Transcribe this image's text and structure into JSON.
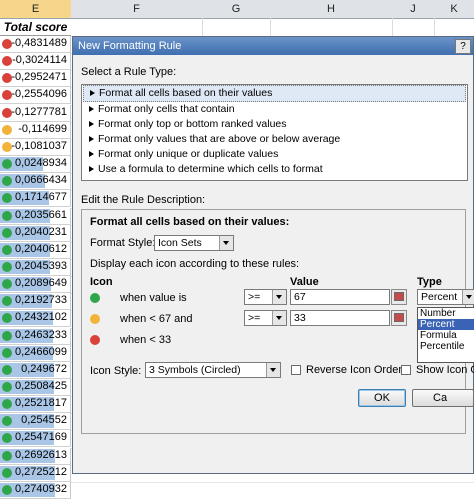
{
  "sheet": {
    "columns": [
      {
        "label": "E",
        "selected": true
      },
      {
        "label": "F",
        "selected": false
      },
      {
        "label": "G",
        "selected": false
      },
      {
        "label": "H",
        "selected": false
      },
      {
        "label": "J",
        "selected": false
      },
      {
        "label": "K",
        "selected": false
      }
    ],
    "header_cell": "Total score",
    "rows": [
      {
        "value": "-0,4831489",
        "icon": "red",
        "bar": 0.0
      },
      {
        "value": "-0,3024114",
        "icon": "red",
        "bar": 0.0
      },
      {
        "value": "-0,2952471",
        "icon": "red",
        "bar": 0.0
      },
      {
        "value": "-0,2554096",
        "icon": "red",
        "bar": 0.0
      },
      {
        "value": "-0,1277781",
        "icon": "red",
        "bar": 0.0
      },
      {
        "value": "-0,114699",
        "icon": "yellow",
        "bar": 0.0
      },
      {
        "value": "-0,1081037",
        "icon": "yellow",
        "bar": 0.0
      },
      {
        "value": "0,0248934",
        "icon": "green",
        "bar": 0.62
      },
      {
        "value": "0,0666434",
        "icon": "green",
        "bar": 0.64
      },
      {
        "value": "0,1714677",
        "icon": "green",
        "bar": 0.7
      },
      {
        "value": "0,2035661",
        "icon": "green",
        "bar": 0.72
      },
      {
        "value": "0,2040231",
        "icon": "green",
        "bar": 0.72
      },
      {
        "value": "0,2040612",
        "icon": "green",
        "bar": 0.72
      },
      {
        "value": "0,2045393",
        "icon": "green",
        "bar": 0.72
      },
      {
        "value": "0,2089649",
        "icon": "green",
        "bar": 0.73
      },
      {
        "value": "0,2192733",
        "icon": "green",
        "bar": 0.74
      },
      {
        "value": "0,2432102",
        "icon": "green",
        "bar": 0.76
      },
      {
        "value": "0,2463233",
        "icon": "green",
        "bar": 0.76
      },
      {
        "value": "0,2466099",
        "icon": "green",
        "bar": 0.76
      },
      {
        "value": "0,249672",
        "icon": "green",
        "bar": 0.77
      },
      {
        "value": "0,2508425",
        "icon": "green",
        "bar": 0.77
      },
      {
        "value": "0,2521817",
        "icon": "green",
        "bar": 0.77
      },
      {
        "value": "0,254552",
        "icon": "green",
        "bar": 0.77
      },
      {
        "value": "0,2547169",
        "icon": "green",
        "bar": 0.77
      },
      {
        "value": "0,2692613",
        "icon": "green",
        "bar": 0.79
      },
      {
        "value": "0,2725212",
        "icon": "green",
        "bar": 0.79
      },
      {
        "value": "0,2740932",
        "icon": "green",
        "bar": 0.79
      }
    ]
  },
  "dialog": {
    "title": "New Formatting Rule",
    "help": "?",
    "select_rule_type_label": "Select a Rule Type:",
    "rule_types": [
      "Format all cells based on their values",
      "Format only cells that contain",
      "Format only top or bottom ranked values",
      "Format only values that are above or below average",
      "Format only unique or duplicate values",
      "Use a formula to determine which cells to format"
    ],
    "edit_label": "Edit the Rule Description:",
    "desc_heading": "Format all cells based on their values:",
    "format_style_label": "Format Style:",
    "format_style_value": "Icon Sets",
    "display_label": "Display each icon according to these rules:",
    "col_icon": "Icon",
    "col_value": "Value",
    "col_type": "Type",
    "rule_rows": [
      {
        "text": "when value is",
        "operator": ">=",
        "value": "67",
        "type": "Percent",
        "icon": "green"
      },
      {
        "text": "when < 67 and",
        "operator": ">=",
        "value": "33",
        "type": "",
        "icon": "yellow"
      },
      {
        "text": "when < 33",
        "operator": "",
        "value": "",
        "type": "",
        "icon": "red"
      }
    ],
    "type_options": [
      "Number",
      "Percent",
      "Formula",
      "Percentile"
    ],
    "type_selected": "Percent",
    "icon_style_label": "Icon Style:",
    "icon_style_value": "3 Symbols (Circled)",
    "reverse_label": "Reverse Icon Order",
    "show_icon_label": "Show Icon On",
    "ok_label": "OK",
    "cancel_label": "Ca"
  },
  "colors": {
    "red": "#d9413b",
    "yellow": "#f1b33a",
    "green": "#2fa64a",
    "title": "#3f6fb0"
  }
}
